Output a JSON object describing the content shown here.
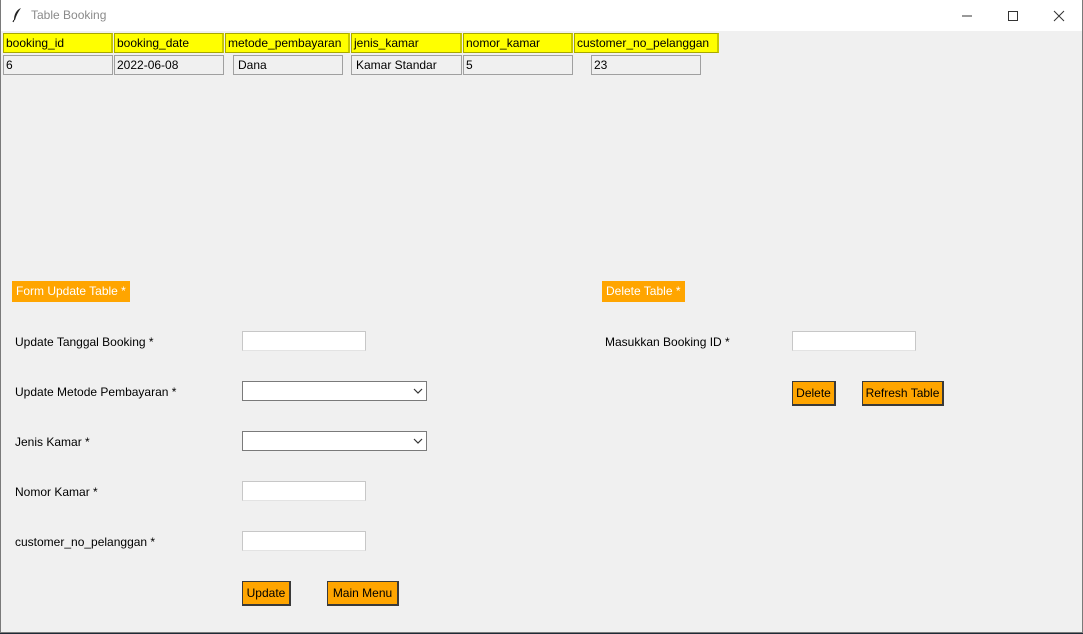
{
  "window": {
    "title": "Table Booking"
  },
  "table": {
    "headers": [
      "booking_id",
      "booking_date",
      "metode_pembayaran",
      "jenis_kamar",
      "nomor_kamar",
      "customer_no_pelanggan"
    ],
    "rows": [
      [
        "6",
        "2022-06-08",
        "Dana",
        "Kamar Standar",
        "5",
        "23"
      ]
    ]
  },
  "update_form": {
    "title": "Form Update Table *",
    "fields": [
      {
        "label": "Update Tanggal Booking *",
        "value": ""
      },
      {
        "label": "Update Metode Pembayaran *",
        "value": ""
      },
      {
        "label": "Jenis Kamar *",
        "value": ""
      },
      {
        "label": "Nomor Kamar *",
        "value": ""
      },
      {
        "label": "customer_no_pelanggan *",
        "value": ""
      }
    ],
    "update_label": "Update",
    "main_menu_label": "Main Menu"
  },
  "delete_form": {
    "title": "Delete Table *",
    "booking_id_label": "Masukkan Booking ID *",
    "booking_id_value": "",
    "delete_label": "Delete",
    "refresh_label": "Refresh Table"
  },
  "colors": {
    "header_bg": "#ffff00",
    "accent": "#ffa500"
  }
}
